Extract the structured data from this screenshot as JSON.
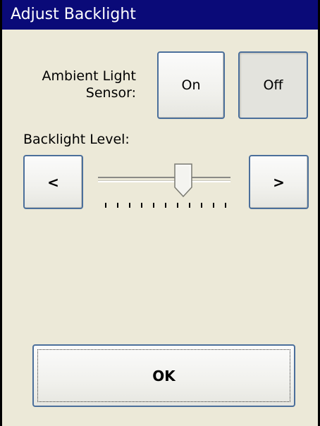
{
  "dialog": {
    "title": "Adjust Backlight",
    "ambient_label_line1": "Ambient Light",
    "ambient_label_line2": "Sensor:",
    "on_label": "On",
    "off_label": "Off",
    "backlight_level_label": "Backlight Level:",
    "decrease_label": "<",
    "increase_label": ">",
    "ok_label": "OK"
  },
  "slider": {
    "tick_count": 11,
    "value_fraction": 0.65
  },
  "colors": {
    "titlebar": "#0a0a78",
    "background": "#ece9d8",
    "button_border": "#4b6f9b"
  }
}
